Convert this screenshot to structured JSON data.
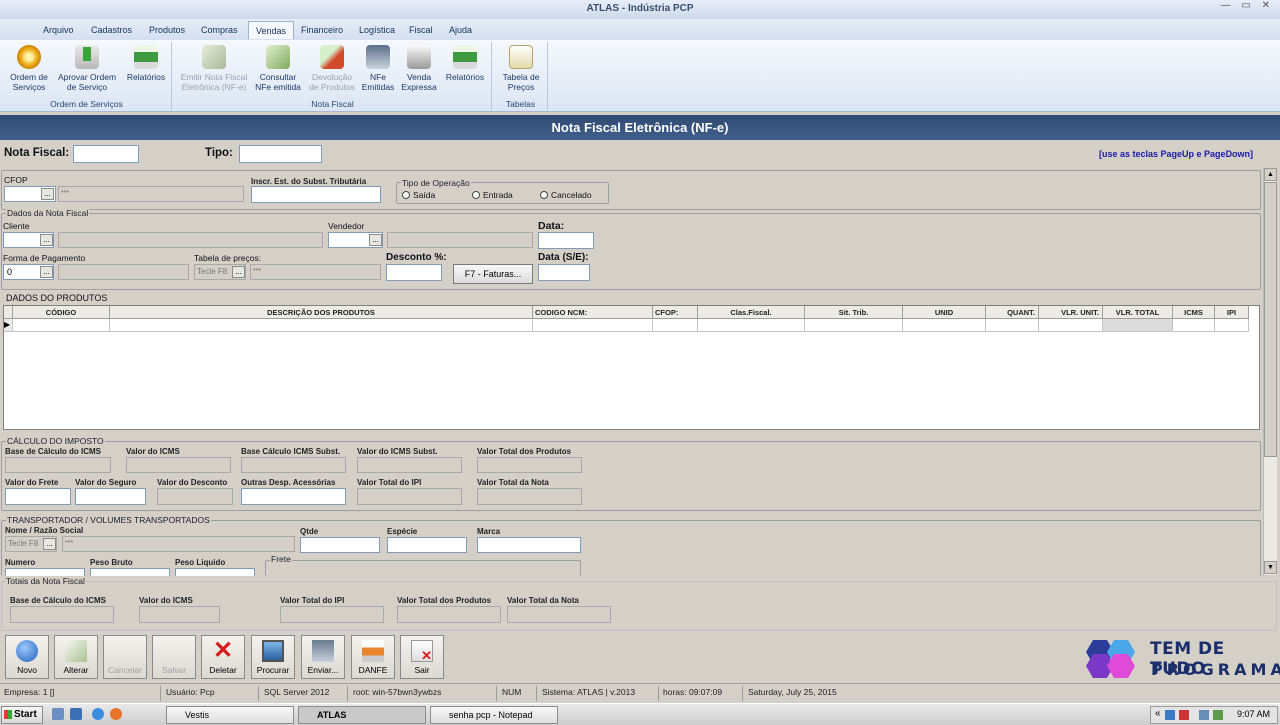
{
  "window": {
    "title": "ATLAS - Indústria PCP"
  },
  "menu": [
    "Arquivo",
    "Cadastros",
    "Produtos",
    "Compras",
    "Vendas",
    "Financeiro",
    "Logística",
    "Fiscal",
    "Ajuda"
  ],
  "ribbon": {
    "groups": [
      "Ordem de Serviços",
      "Nota Fiscal",
      "Tabelas"
    ],
    "buttons": [
      {
        "label": "Ordem de\nServiços",
        "icon": "gear-icon"
      },
      {
        "label": "Aprovar Ordem\nde Serviço",
        "icon": "download-arrow-icon"
      },
      {
        "label": "Relatórios",
        "icon": "printer-icon"
      },
      {
        "label": "Emitir Nota Fiscal\nEletrônica (NF-e)",
        "icon": "nfe-icon"
      },
      {
        "label": "Consultar\nNFe emitida",
        "icon": "nfe-search-icon"
      },
      {
        "label": "Devolução\nde Produtos",
        "icon": "return-arrow-icon"
      },
      {
        "label": "NFe\nEmitidas",
        "icon": "document-stack-icon"
      },
      {
        "label": "Venda\nExpressa",
        "icon": "cash-register-icon"
      },
      {
        "label": "Relatórios",
        "icon": "printer-icon"
      },
      {
        "label": "Tabela de\nPreços",
        "icon": "price-table-icon"
      }
    ]
  },
  "form": {
    "title": "Nota Fiscal Eletrônica (NF-e)",
    "nota_fiscal_label": "Nota Fiscal:",
    "tipo_label": "Tipo:",
    "hint": "[use as teclas PageUp e PageDown]",
    "cfop_label": "CFOP",
    "cfop_desc": "***",
    "inscr_label": "Inscr. Est. do Subst. Tributária",
    "tipo_operacao": {
      "title": "Tipo de Operação",
      "options": [
        "Saída",
        "Entrada",
        "Cancelado"
      ]
    },
    "dados_title": "Dados da Nota Fiscal",
    "cliente_label": "Cliente",
    "vendedor_label": "Vendedor",
    "data_label": "Data:",
    "forma_pagamento_label": "Forma de Pagamento",
    "forma_pagamento_value": "0",
    "tabela_precos_label": "Tabela de preços:",
    "tabela_precos_value": "Tecle F8",
    "tabela_precos_desc": "***",
    "desconto_label": "Desconto %:",
    "faturas_button": "F7 - Faturas...",
    "data_se_label": "Data (S/E):",
    "dots": "..."
  },
  "produtos": {
    "title": "DADOS DO PRODUTOS",
    "columns": [
      "CÓDIGO",
      "DESCRIÇÃO DOS PRODUTOS",
      "CODIGO NCM:",
      "CFOP:",
      "Clas.Fiscal.",
      "Sit. Trib.",
      "UNID",
      "QUANT.",
      "VLR. UNIT.",
      "VLR. TOTAL",
      "ICMS",
      "IPI"
    ]
  },
  "imposto": {
    "title": "CÁLCULO DO IMPOSTO",
    "labels": [
      "Base de Cálculo do ICMS",
      "Valor do ICMS",
      "Base Cálculo ICMS Subst.",
      "Valor do ICMS Subst.",
      "Valor Total dos Produtos",
      "Valor do Frete",
      "Valor do Seguro",
      "Valor do Desconto",
      "Outras Desp. Acessórias",
      "Valor Total do IPI",
      "Valor Total da Nota"
    ]
  },
  "transportador": {
    "title": "TRANSPORTADOR / VOLUMES TRANSPORTADOS",
    "nome_label": "Nome / Razão Social",
    "nome_value": "Tecle F8",
    "nome_desc": "***",
    "qtde_label": "Qtde",
    "especie_label": "Espécie",
    "marca_label": "Marca",
    "numero_label": "Numero",
    "peso_bruto_label": "Peso Bruto",
    "peso_liquido_label": "Peso Liquido",
    "frete_label": "Frete"
  },
  "totais": {
    "title": "Totais da Nota Fiscal",
    "labels": [
      "Base de Cálculo do ICMS",
      "Valor do ICMS",
      "Valor Total do IPI",
      "Valor Total dos Produtos",
      "Valor Total da Nota"
    ]
  },
  "toolbar": [
    {
      "label": "Novo",
      "icon": "plus-circle-icon",
      "enabled": true
    },
    {
      "label": "Alterar",
      "icon": "edit-icon",
      "enabled": true
    },
    {
      "label": "Cancelar",
      "icon": "cancel-icon",
      "enabled": false
    },
    {
      "label": "Salvar",
      "icon": "save-icon",
      "enabled": false
    },
    {
      "label": "Deletar",
      "icon": "red-x-icon",
      "enabled": true
    },
    {
      "label": "Procurar",
      "icon": "search-monitor-icon",
      "enabled": true
    },
    {
      "label": "Enviar...",
      "icon": "send-icon",
      "enabled": true
    },
    {
      "label": "DANFE",
      "icon": "printer-icon",
      "enabled": true
    },
    {
      "label": "Sair",
      "icon": "exit-icon",
      "enabled": true
    }
  ],
  "logo": {
    "line1": "TEM DE TUDO",
    "line2": "PROGRAMAS"
  },
  "status": [
    "Empresa: 1 []",
    "Usuário: Pcp",
    "SQL Server 2012",
    "root: win-57bwn3ywbzs",
    "NUM",
    "Sistema: ATLAS | v.2013",
    "horas: 09:07:09",
    "Saturday, July 25, 2015"
  ],
  "taskbar": {
    "start": "Start",
    "tasks": [
      "Vestis",
      "ATLAS",
      "senha pcp - Notepad"
    ],
    "clock": "9:07 AM"
  }
}
